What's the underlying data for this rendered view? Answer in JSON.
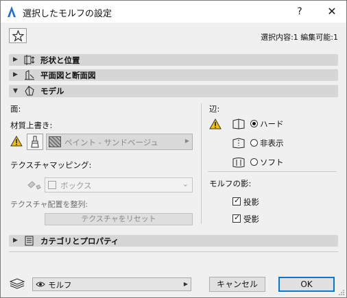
{
  "window": {
    "title": "選択したモルフの設定",
    "help_label": "?",
    "close_label": "✕"
  },
  "info": {
    "selection": "選択内容:1 編集可能:1"
  },
  "sections": {
    "shape": "形状と位置",
    "plan": "平面図と断面図",
    "model": "モデル",
    "category": "カテゴリとプロパティ"
  },
  "face": {
    "header": "面:",
    "material_override_label": "材質上書き:",
    "material_value": "ペイント - サンドベージュ",
    "texture_mapping_label": "テクスチャマッピング:",
    "texture_value": "ボックス",
    "align_texture_label": "テクスチャ配置を整列:",
    "reset_texture_button": "テクスチャをリセット"
  },
  "edges": {
    "header": "辺:",
    "options": [
      "ハード",
      "非表示",
      "ソフト"
    ],
    "selected": "ハード"
  },
  "shadow": {
    "header": "モルフの影:",
    "cast_label": "投影",
    "cast_checked": true,
    "receive_label": "受影",
    "receive_checked": true
  },
  "footer": {
    "layer_value": "モルフ",
    "cancel_button": "キャンセル",
    "ok_button": "OK"
  },
  "colors": {
    "accent": "#0078d7",
    "warning": "#f2c200",
    "section_bg": "#d6d6d6",
    "dialog_bg": "#f0f0f0"
  }
}
